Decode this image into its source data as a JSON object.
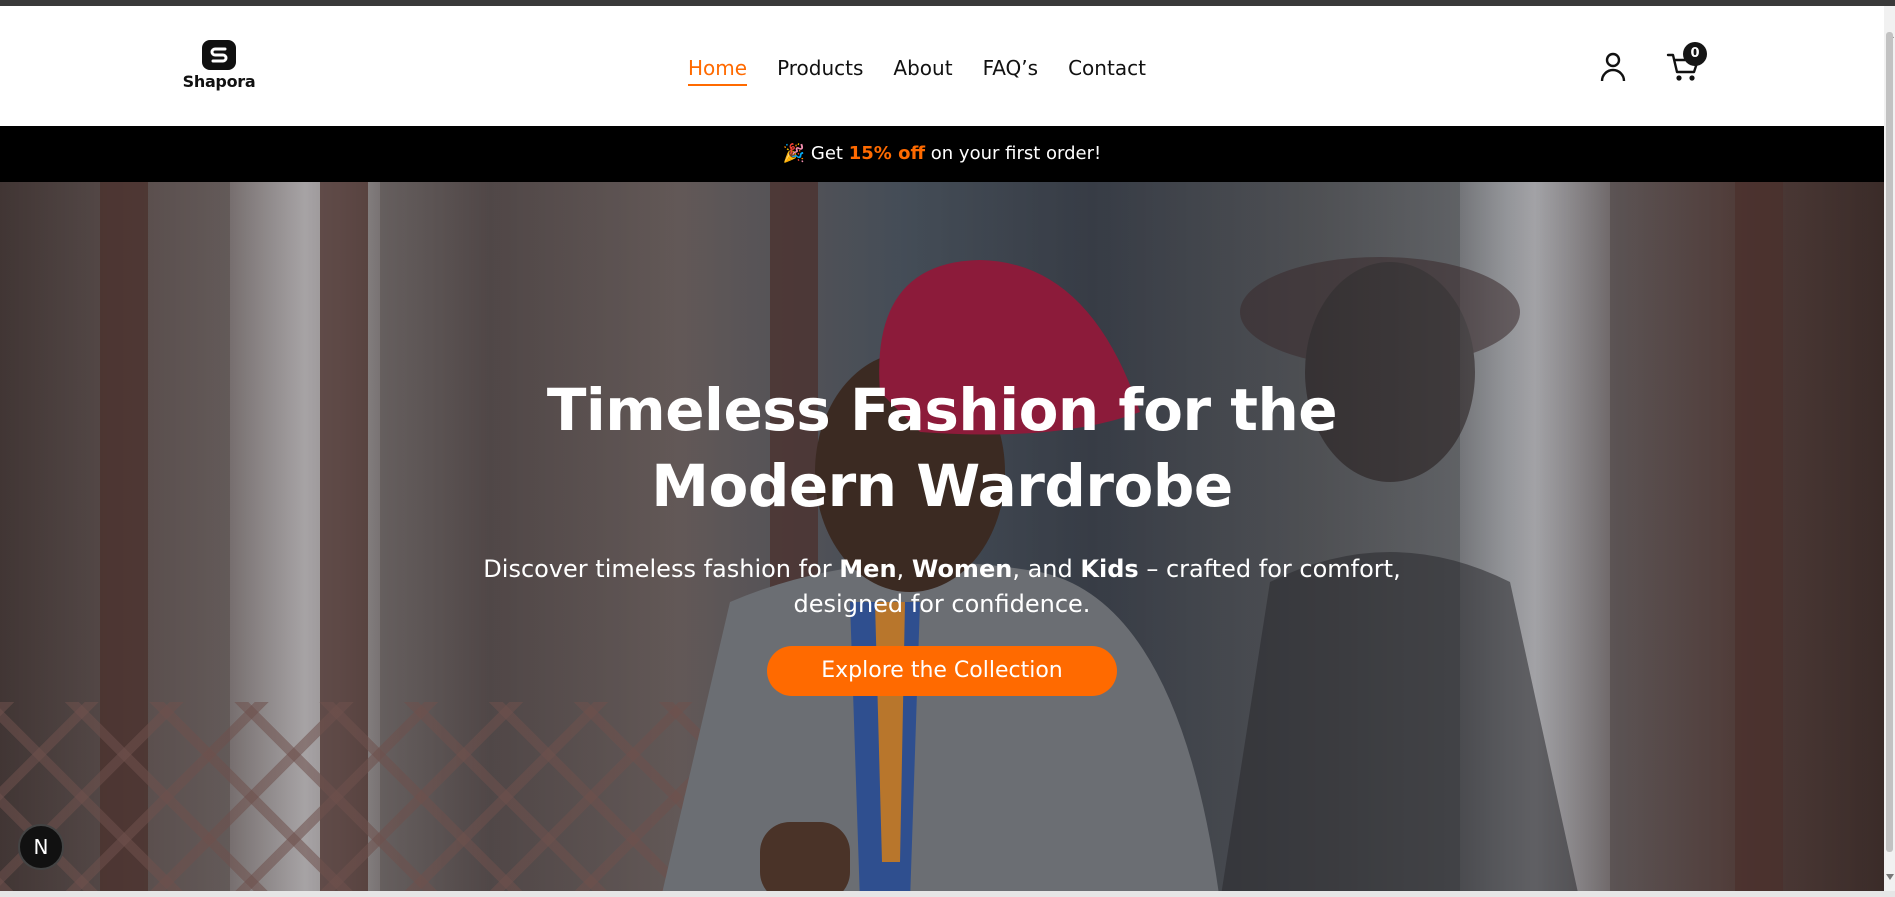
{
  "brand": {
    "name": "Shapora",
    "accent": "#ff6a00"
  },
  "nav": {
    "items": [
      {
        "label": "Home",
        "active": true
      },
      {
        "label": "Products",
        "active": false
      },
      {
        "label": "About",
        "active": false
      },
      {
        "label": "FAQ’s",
        "active": false
      },
      {
        "label": "Contact",
        "active": false
      }
    ]
  },
  "header": {
    "user_icon": "user-icon",
    "cart_icon": "cart-icon",
    "cart_count": "0"
  },
  "promo": {
    "emoji": "🎉",
    "prefix": "Get",
    "highlight": "15% off",
    "suffix": "on your first order!"
  },
  "hero": {
    "title_line1": "Timeless Fashion for the",
    "title_line2": "Modern Wardrobe",
    "sub_prefix": "Discover timeless fashion for",
    "men": "Men",
    "sep1": ",",
    "women": "Women",
    "sep2": ", and",
    "kids": "Kids",
    "sub_suffix": "– crafted for comfort, designed for confidence.",
    "cta_label": "Explore the Collection"
  },
  "dev_badge": {
    "label": "N"
  }
}
